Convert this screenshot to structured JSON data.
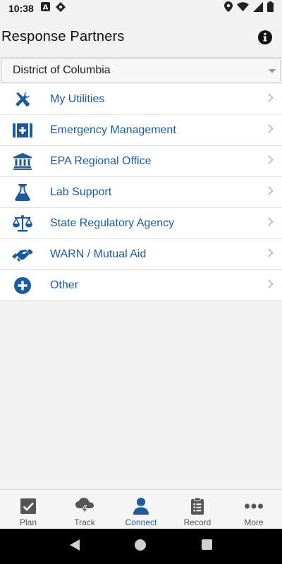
{
  "status_bar": {
    "time": "10:38",
    "left_icons": [
      "a-square-icon",
      "diamond-icon"
    ],
    "right_icons": [
      "location-icon",
      "wifi-icon",
      "signal-icon",
      "battery-icon"
    ]
  },
  "header": {
    "title": "Response Partners",
    "info_icon": "info-icon"
  },
  "region_select": {
    "value": "District of Columbia"
  },
  "partners": [
    {
      "label": "My Utilities",
      "icon": "tools-icon"
    },
    {
      "label": "Emergency Management",
      "icon": "medical-kit-icon"
    },
    {
      "label": "EPA Regional Office",
      "icon": "government-building-icon"
    },
    {
      "label": "Lab Support",
      "icon": "flask-icon"
    },
    {
      "label": "State Regulatory Agency",
      "icon": "balance-scale-icon"
    },
    {
      "label": "WARN / Mutual Aid",
      "icon": "handshake-icon"
    },
    {
      "label": "Other",
      "icon": "plus-circle-icon"
    }
  ],
  "bottom_nav": {
    "items": [
      {
        "label": "Plan",
        "icon": "checkbox-icon"
      },
      {
        "label": "Track",
        "icon": "storm-cloud-icon"
      },
      {
        "label": "Connect",
        "icon": "person-icon"
      },
      {
        "label": "Record",
        "icon": "clipboard-icon"
      },
      {
        "label": "More",
        "icon": "more-dots-icon"
      }
    ],
    "active": "Connect"
  },
  "colors": {
    "accent": "#1c5a9e",
    "text": "#111111",
    "background": "#f2f2f2"
  }
}
